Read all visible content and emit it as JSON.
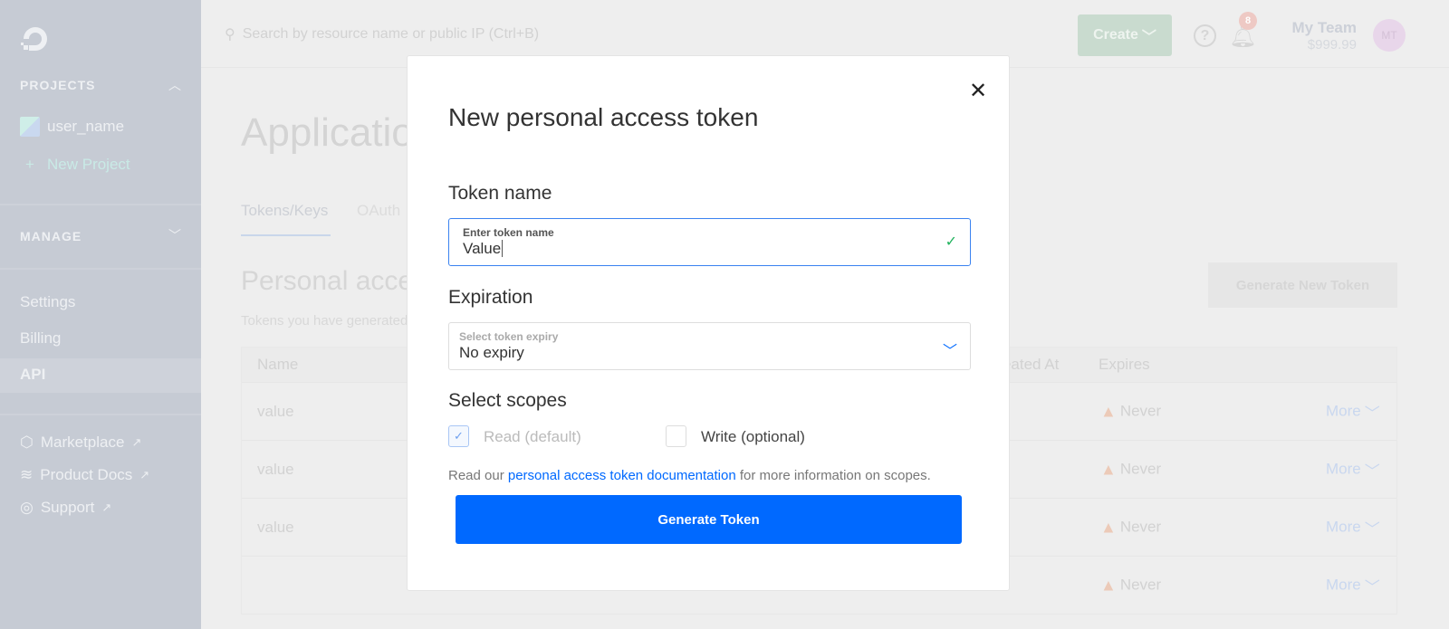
{
  "sidebar": {
    "projects_heading": "PROJECTS",
    "project_name": "user_name",
    "new_project": "New Project",
    "manage_heading": "MANAGE",
    "items": [
      {
        "label": "Settings"
      },
      {
        "label": "Billing"
      },
      {
        "label": "API",
        "active": true
      }
    ],
    "links": [
      {
        "label": "Marketplace",
        "icon": "cube-icon"
      },
      {
        "label": "Product Docs",
        "icon": "layers-icon"
      },
      {
        "label": "Support",
        "icon": "lifebuoy-icon"
      }
    ],
    "external_glyph": "↗"
  },
  "header": {
    "search_placeholder": "Search by resource name or public IP (Ctrl+B)",
    "create_label": "Create",
    "notification_count": "8",
    "team_name": "My Team",
    "balance": "$999.99",
    "avatar_initials": "MT"
  },
  "page": {
    "title": "Applications & API",
    "tabs": [
      "Tokens/Keys",
      "OAuth"
    ],
    "section_title": "Personal access tokens",
    "section_sub": "Tokens you have generated to access the DigitalOcean API",
    "generate_new_label": "Generate New Token",
    "table": {
      "headers": [
        "Name",
        "Created At",
        "Expires"
      ],
      "rows": [
        {
          "name": "value",
          "expires": "Never",
          "more": "More"
        },
        {
          "name": "value",
          "expires": "Never",
          "more": "More"
        },
        {
          "name": "value",
          "expires": "Never",
          "more": "More"
        },
        {
          "name": "",
          "expires": "Never",
          "more": "More"
        }
      ]
    }
  },
  "modal": {
    "title": "New personal access token",
    "token_name_label": "Token name",
    "token_field_label": "Enter token name",
    "token_field_value": "Value",
    "expiration_label": "Expiration",
    "expiry_field_label": "Select token expiry",
    "expiry_value": "No expiry",
    "scopes_label": "Select scopes",
    "scopes": [
      {
        "label": "Read (default)",
        "checked": true,
        "disabled": true
      },
      {
        "label": "Write (optional)",
        "checked": false
      }
    ],
    "info_prefix": "Read our ",
    "info_link": "personal access token documentation",
    "info_suffix": " for more information on scopes.",
    "generate_label": "Generate Token"
  },
  "colors": {
    "primary": "#0069ff",
    "valid": "#22b35e",
    "sidebar": "#c6cbd4"
  }
}
